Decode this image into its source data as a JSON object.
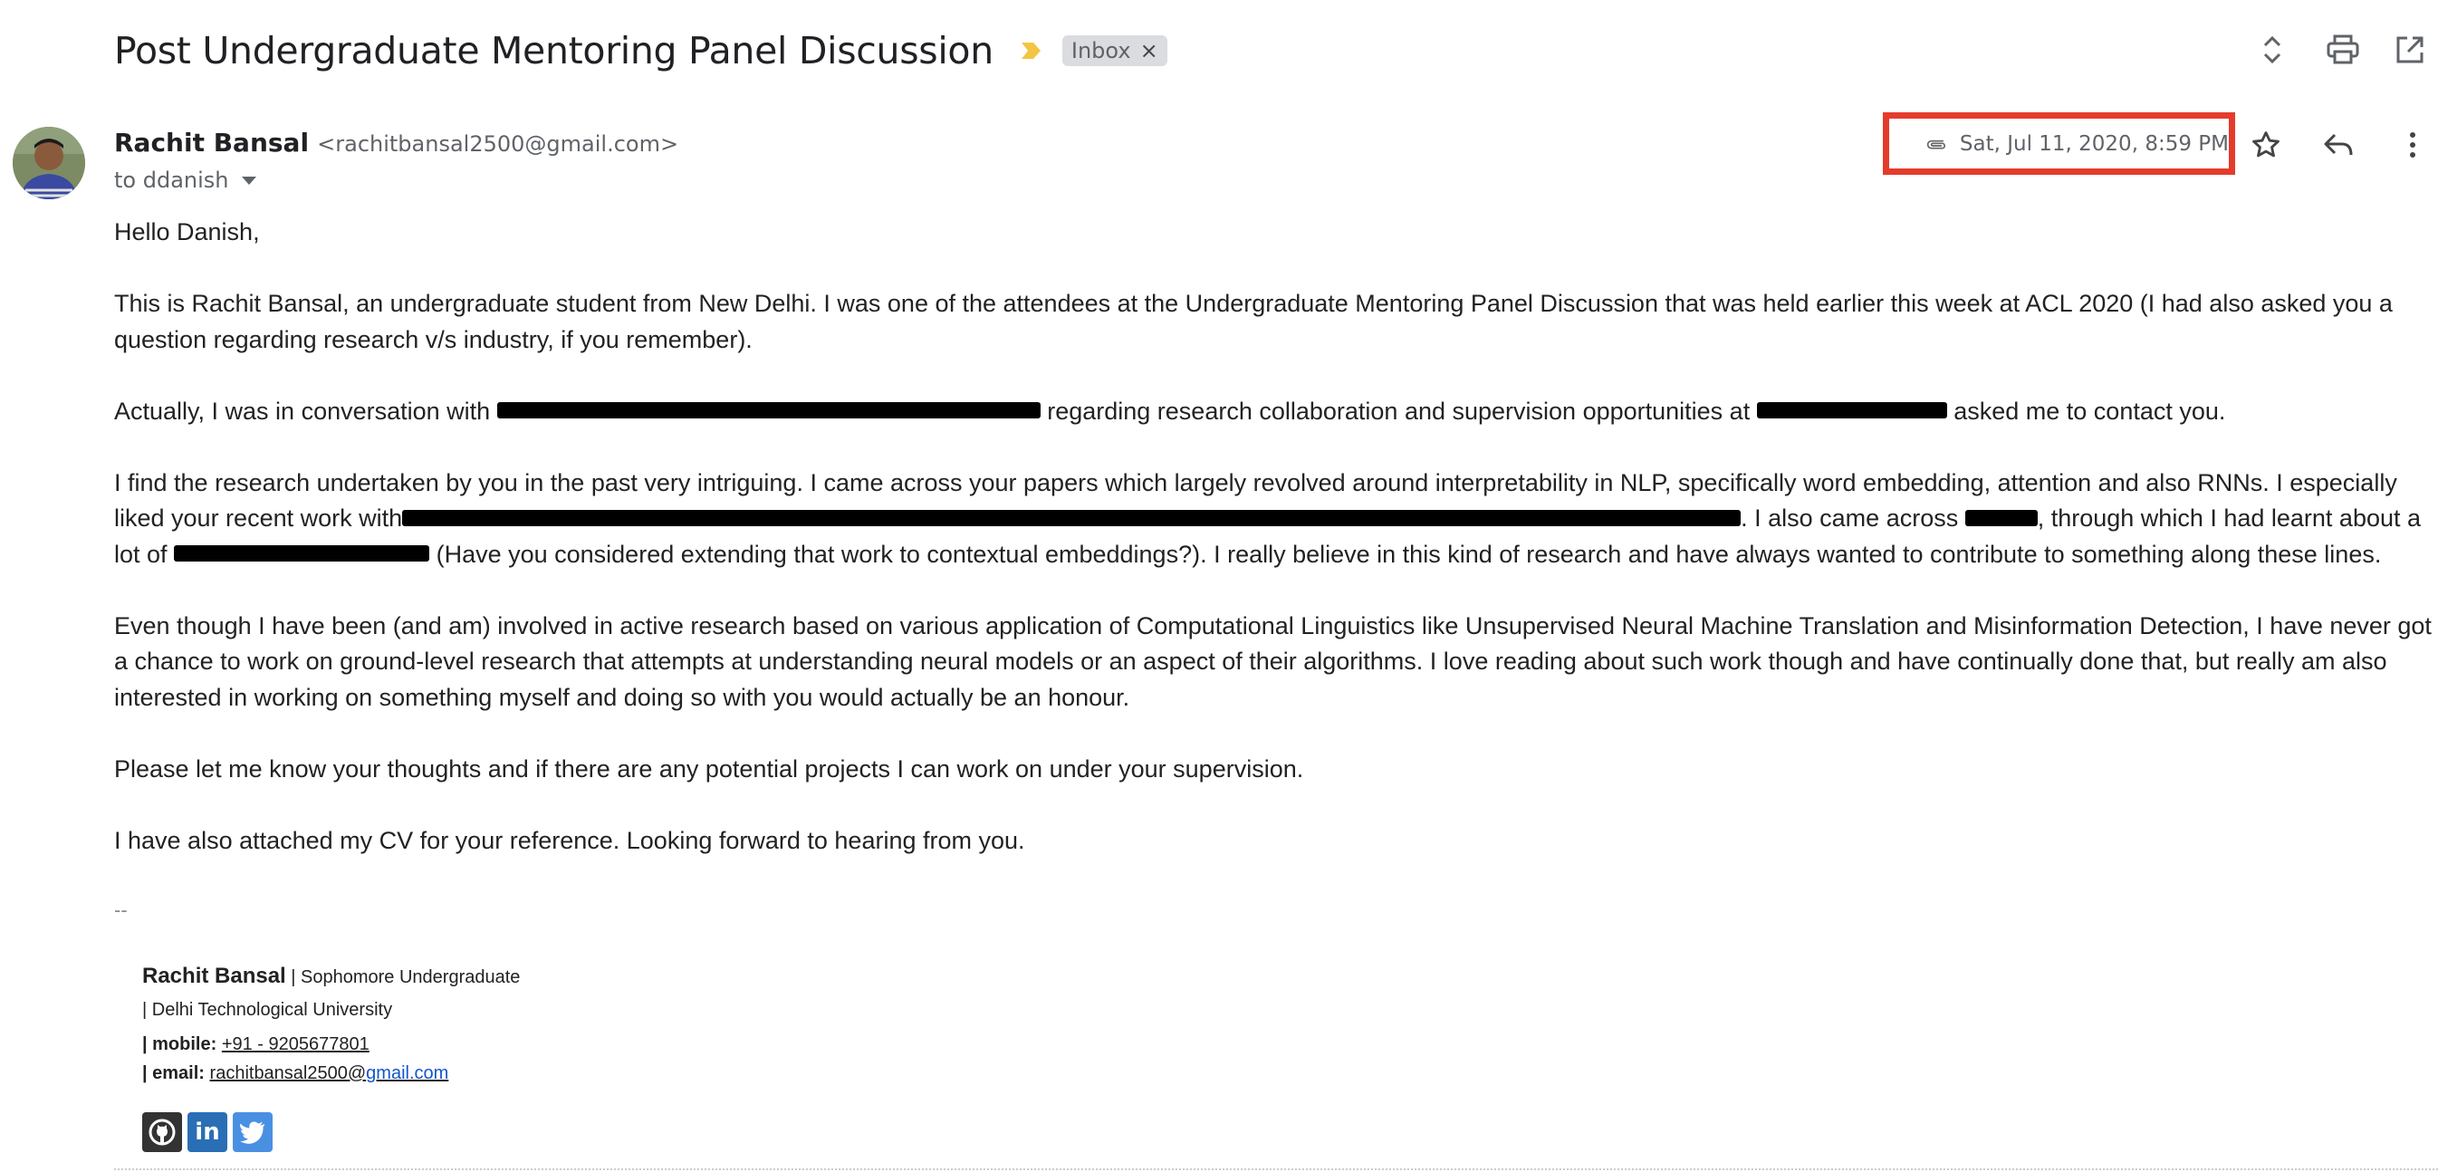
{
  "email": {
    "subject": "Post Undergraduate Mentoring Panel Discussion",
    "label": "Inbox",
    "label_remove": "×",
    "sender_name": "Rachit Bansal",
    "sender_email": "<rachitbansal2500@gmail.com>",
    "to": "to ddanish",
    "date": "Sat, Jul 11, 2020, 8:59 PM"
  },
  "body": {
    "greeting": "Hello Danish,",
    "p1": "This is Rachit Bansal, an undergraduate student from New Delhi. I was one of the attendees at the Undergraduate Mentoring Panel Discussion that was held earlier this week at ACL 2020 (I had also asked you a question regarding research v/s industry, if you remember).",
    "p2_a": "Actually, I was in conversation with",
    "p2_b": "regarding research collaboration and supervision opportunities at",
    "p2_c": "asked me to contact you.",
    "p3_a": "I find the research undertaken by you in the past very intriguing. I came across your papers which largely revolved around interpretability in NLP, specifically word embedding, attention and also RNNs. I especially liked your recent work with",
    "p3_b": ". I also came across",
    "p3_c": ", through which I had learnt about a lot of",
    "p3_d": "(Have you considered extending that work to contextual embeddings?). I really believe in this kind of research and have always wanted to contribute to something along these lines.",
    "p4": "Even though I have been (and am) involved in active research based on various application of Computational Linguistics like Unsupervised Neural Machine Translation and Misinformation Detection, I have never got a chance to work on ground-level research that attempts at understanding neural models or an aspect of their algorithms. I love reading about such work though and have continually done that, but really am also interested in working on something myself and doing so with you would actually be an honour.",
    "p5": "Please let me know your thoughts and if there are any potential projects I can work on under your supervision.",
    "p6": "I have also attached my CV for your reference. Looking forward to hearing from you."
  },
  "signature": {
    "dash": "--",
    "name": "Rachit Bansal",
    "title": "| Sophomore Undergraduate",
    "university": "| Delhi Technological University",
    "mobile_label": "| mobile:",
    "mobile": "+91 - 9205677801",
    "email_label": "| email:",
    "email_user": "rachitbansal2500@",
    "email_domain": "gmail.com"
  },
  "social": {
    "github_icon": "github-icon",
    "linkedin_icon": "linkedin-icon",
    "linkedin_text": "in",
    "twitter_icon": "twitter-icon"
  },
  "colors": {
    "highlight_box": "#e53b2c",
    "importance_marker": "#f4c542",
    "label_chip_bg": "#dadce0",
    "link_blue": "#1155cc",
    "github_bg": "#333333",
    "linkedin_bg": "#2a6fb5",
    "twitter_bg": "#4a90e2"
  }
}
